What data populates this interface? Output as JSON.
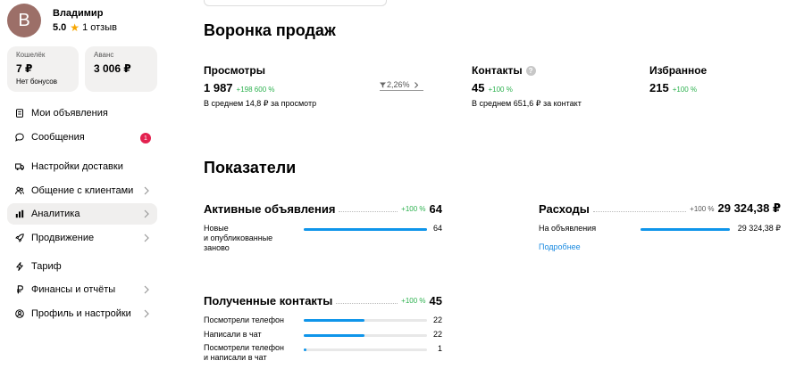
{
  "profile": {
    "avatar_letter": "В",
    "name": "Владимир",
    "rating": "5.0",
    "reviews": "1 отзыв"
  },
  "wallet": {
    "purse_label": "Кошелёк",
    "purse_amount": "7 ₽",
    "purse_sub": "Нет бонусов",
    "advance_label": "Аванс",
    "advance_amount": "3 006 ₽"
  },
  "sidebar": {
    "items": [
      {
        "label": "Мои объявления",
        "icon": "document-icon"
      },
      {
        "label": "Сообщения",
        "icon": "chat-icon",
        "badge": "1"
      },
      {
        "label": "Настройки доставки",
        "icon": "truck-icon"
      },
      {
        "label": "Общение с клиентами",
        "icon": "people-icon"
      },
      {
        "label": "Аналитика",
        "icon": "chart-icon",
        "active": true
      },
      {
        "label": "Продвижение",
        "icon": "rocket-icon"
      },
      {
        "label": "Тариф",
        "icon": "bolt-icon"
      },
      {
        "label": "Финансы и отчёты",
        "icon": "ruble-icon"
      },
      {
        "label": "Профиль и настройки",
        "icon": "profile-icon"
      }
    ]
  },
  "funnel": {
    "title": "Воронка продаж",
    "views": {
      "title": "Просмотры",
      "value": "1 987",
      "delta": "+198 600 %",
      "note": "В среднем 14,8 ₽ за просмотр"
    },
    "conversion": "2,26%",
    "contacts": {
      "title": "Контакты",
      "value": "45",
      "delta": "+100 %",
      "note": "В среднем 651,6 ₽ за контакт"
    },
    "favorites": {
      "title": "Избранное",
      "value": "215",
      "delta": "+100 %"
    }
  },
  "indicators": {
    "title": "Показатели",
    "active_ads": {
      "title": "Активные объявления",
      "delta": "+100 %",
      "total": "64",
      "rows": [
        {
          "label_line1": "Новые",
          "label_line2": "и опубликованные",
          "label_line3": "заново",
          "value": "64",
          "fill": 1.0
        }
      ]
    },
    "expenses": {
      "title": "Расходы",
      "delta": "+100 %",
      "total": "29 324,38 ₽",
      "rows": [
        {
          "label": "На объявления",
          "value": "29 324,38 ₽",
          "fill": 1.0
        }
      ],
      "more_link": "Подробнее"
    },
    "received_contacts": {
      "title": "Полученные контакты",
      "delta": "+100 %",
      "total": "45",
      "rows": [
        {
          "label": "Посмотрели телефон",
          "value": "22",
          "fill": 0.49
        },
        {
          "label": "Написали в чат",
          "value": "22",
          "fill": 0.49
        },
        {
          "label_line1": "Посмотрели телефон",
          "label_line2": "и написали в чат",
          "value": "1",
          "fill": 0.022
        }
      ]
    }
  },
  "colors": {
    "accent": "#0f95ea",
    "positive": "#2db14f",
    "badge": "#e3214f",
    "avatar": "#9c6f68"
  }
}
